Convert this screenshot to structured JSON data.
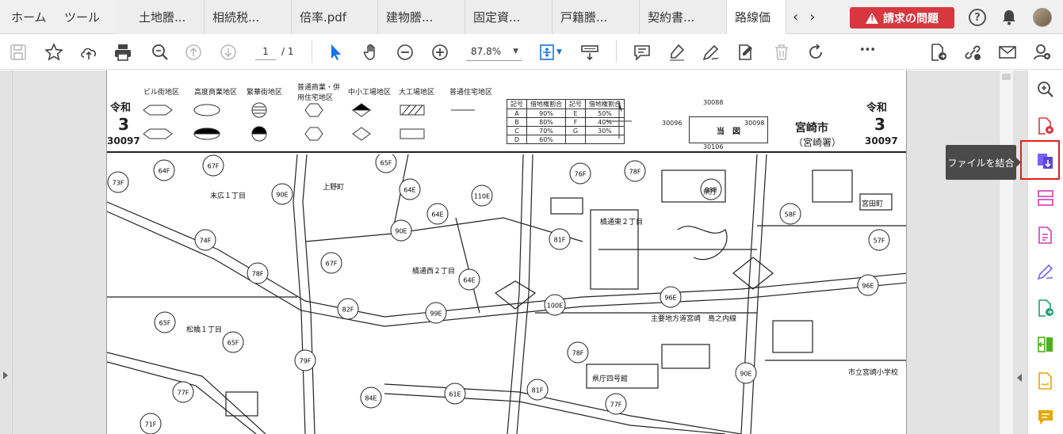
{
  "tabs": {
    "home": "ホーム",
    "tools": "ツール",
    "documents": [
      {
        "label": "土地謄..."
      },
      {
        "label": "相続税..."
      },
      {
        "label": "倍率.pdf"
      },
      {
        "label": "建物謄..."
      },
      {
        "label": "固定資..."
      },
      {
        "label": "戸籍謄..."
      },
      {
        "label": "契約書..."
      },
      {
        "label": "路線価"
      }
    ],
    "alert_label": "請求の問題",
    "help_glyph": "?"
  },
  "toolbar": {
    "page_current": "1",
    "page_total": "/ 1",
    "zoom": "87.8%",
    "more_glyph": "•••"
  },
  "document": {
    "era_left": "令和",
    "num_left": "3",
    "code_left": "30097",
    "era_right": "令和",
    "num_right": "3",
    "code_right": "30097",
    "city": "宮崎市",
    "office": "（宮崎署）",
    "legend": [
      "ビル街地区",
      "高度商業地区",
      "繁華街地区",
      "普通商業・併用住宅地区",
      "中小工場地区",
      "大工場地区",
      "普通住宅地区"
    ],
    "rate_table": [
      [
        "記号",
        "借地権割合",
        "記号",
        "借地権割合"
      ],
      [
        "A",
        "90%",
        "E",
        "50%"
      ],
      [
        "B",
        "80%",
        "F",
        "40%"
      ],
      [
        "C",
        "70%",
        "G",
        "30%"
      ],
      [
        "D",
        "60%",
        "",
        ""
      ]
    ],
    "sheet": {
      "label": "当　図",
      "north": "30088",
      "south": "30106",
      "west": "30096",
      "east": "30098"
    },
    "map_labels": {
      "suehiro": "末広１丁目",
      "ueno": "上野町",
      "tachibana_nishi": "橘通西２丁目",
      "tachibana_higashi": "橘通東２丁目",
      "matsuhashi": "松橋１丁目",
      "miyata": "宮田町",
      "prefecture_office": "県庁",
      "joint_office": "主要地方道宮崎　島之内線",
      "school": "市立宮崎小学校",
      "pref_no4": "県庁四号館"
    },
    "route_values": [
      "64F",
      "67F",
      "65F",
      "73F",
      "90E",
      "64E",
      "110E",
      "76F",
      "78F",
      "98E",
      "58F",
      "57F",
      "74F",
      "90E",
      "64E",
      "81F",
      "67F",
      "78F",
      "64E",
      "96E",
      "96E",
      "82F",
      "99E",
      "100E",
      "65F",
      "65F",
      "79F",
      "78F",
      "90E",
      "77F",
      "84E",
      "61E",
      "81F",
      "77F",
      "71F"
    ]
  },
  "tooltip": {
    "text": "ファイルを結合"
  }
}
